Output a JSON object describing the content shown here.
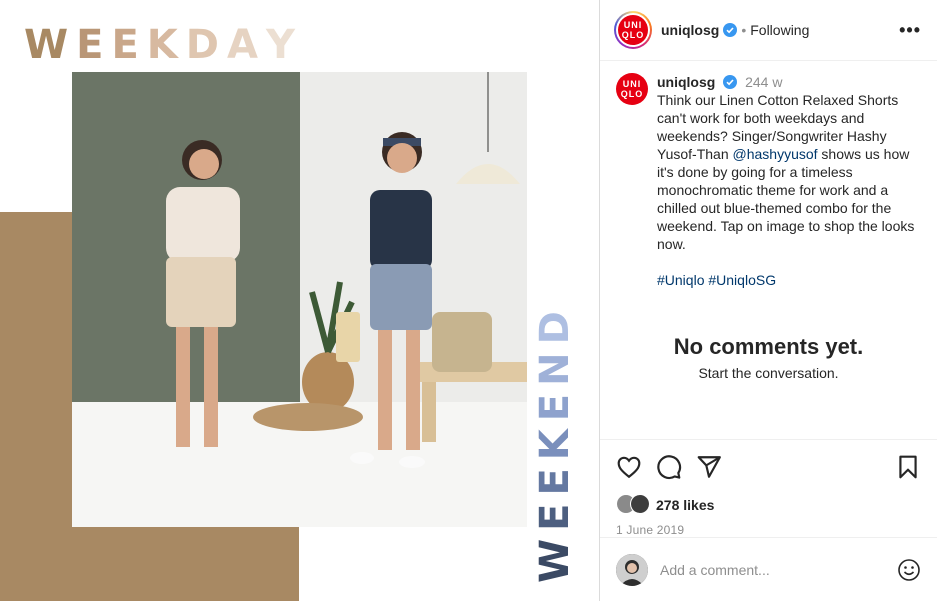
{
  "post_image": {
    "weekday_letters": [
      "W",
      "E",
      "E",
      "K",
      "D",
      "A",
      "Y"
    ],
    "weekday_colors": [
      "#a88963",
      "#b99676",
      "#c9a78a",
      "#d7b9a0",
      "#dfc6b0",
      "#e6d3c2",
      "#ecdfd2"
    ],
    "weekend_letters": [
      "W",
      "E",
      "E",
      "K",
      "E",
      "N",
      "D"
    ],
    "weekend_colors": [
      "#3b4a64",
      "#4d5f80",
      "#6478a1",
      "#7a8fbc",
      "#8ea2cd",
      "#9fb1d8",
      "#aebfe2"
    ],
    "tan_color": "#a88963"
  },
  "header": {
    "logo_lines": [
      "UNI",
      "QLO"
    ],
    "username": "uniqlosg",
    "separator": "•",
    "follow_state": "Following",
    "more_label": "•••"
  },
  "caption": {
    "username": "uniqlosg",
    "age": "244 w",
    "text_before_mention": "Think our Linen Cotton Relaxed Shorts can't work for both weekdays and weekends? Singer/Songwriter Hashy Yusof-Than ",
    "mention": "@hashyyusof",
    "text_after_mention": " shows us how it's done by going for a timeless monochromatic theme for work and a chilled out blue-themed combo for the weekend. Tap on image to shop the looks now.",
    "hashtags": [
      "#Uniqlo",
      "#UniqloSG"
    ]
  },
  "empty_state": {
    "title": "No comments yet.",
    "subtitle": "Start the conversation."
  },
  "actions": {
    "like_icon": "heart-icon",
    "comment_icon": "comment-bubble-icon",
    "share_icon": "paper-plane-icon",
    "save_icon": "bookmark-icon"
  },
  "likes": {
    "count_label": "278 likes",
    "date": "1 June 2019"
  },
  "comment_bar": {
    "placeholder": "Add a comment...",
    "emoji_icon": "smiley-icon"
  }
}
